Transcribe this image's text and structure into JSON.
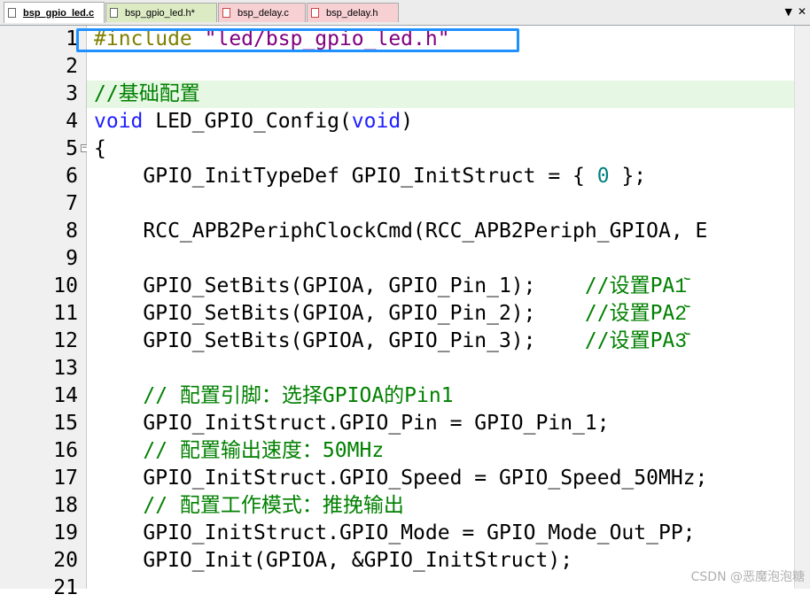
{
  "tabs": [
    {
      "label": "bsp_gpio_led.c",
      "state": "active"
    },
    {
      "label": "bsp_gpio_led.h*",
      "state": "green"
    },
    {
      "label": "bsp_delay.c",
      "state": "pink"
    },
    {
      "label": "bsp_delay.h",
      "state": "pink"
    }
  ],
  "tab_menu_icon": "▼",
  "tab_close_icon": "✕",
  "lines": [
    {
      "n": "1"
    },
    {
      "n": "2"
    },
    {
      "n": "3"
    },
    {
      "n": "4"
    },
    {
      "n": "5"
    },
    {
      "n": "6"
    },
    {
      "n": "7"
    },
    {
      "n": "8"
    },
    {
      "n": "9"
    },
    {
      "n": "10"
    },
    {
      "n": "11"
    },
    {
      "n": "12"
    },
    {
      "n": "13"
    },
    {
      "n": "14"
    },
    {
      "n": "15"
    },
    {
      "n": "16"
    },
    {
      "n": "17"
    },
    {
      "n": "18"
    },
    {
      "n": "19"
    },
    {
      "n": "20"
    },
    {
      "n": "21"
    }
  ],
  "code": {
    "l1_dir": "#include",
    "l1_str": " \"led/bsp_gpio_led.h\"",
    "l3_cm": "//基础配置",
    "l4_kw1": "void",
    "l4_mid": " LED_GPIO_Config(",
    "l4_kw2": "void",
    "l4_end": ")",
    "l5": "{",
    "l6_a": "    GPIO_InitTypeDef GPIO_InitStruct = { ",
    "l6_num": "0",
    "l6_b": " };",
    "l8": "    RCC_APB2PeriphClockCmd(RCC_APB2Periph_GPIOA, E",
    "l10_code": "    GPIO_SetBits(GPIOA, GPIO_Pin_1);    ",
    "l10_cm": "//设置PA1᷅",
    "l11_code": "    GPIO_SetBits(GPIOA, GPIO_Pin_2);    ",
    "l11_cm": "//设置PA2᷅",
    "l12_code": "    GPIO_SetBits(GPIOA, GPIO_Pin_3);    ",
    "l12_cm": "//设置PA3᷅",
    "l14_cm": "    // 配置引脚：选择GPIOA的Pin1",
    "l15": "    GPIO_InitStruct.GPIO_Pin = GPIO_Pin_1;",
    "l16_cm": "    // 配置输出速度：50MHz",
    "l17": "    GPIO_InitStruct.GPIO_Speed = GPIO_Speed_50MHz;",
    "l18_cm": "    // 配置工作模式：推挽输出",
    "l19": "    GPIO_InitStruct.GPIO_Mode = GPIO_Mode_Out_PP;",
    "l20": "    GPIO_Init(GPIOA, &GPIO_InitStruct);"
  },
  "fold_marker": "−",
  "watermark": "CSDN @恶魔泡泡糖",
  "colors": {
    "keyword": "#2020ff",
    "preprocessor": "#808000",
    "string": "#800080",
    "comment": "#008000",
    "number": "#008080",
    "highlight": "#1e90ff"
  }
}
